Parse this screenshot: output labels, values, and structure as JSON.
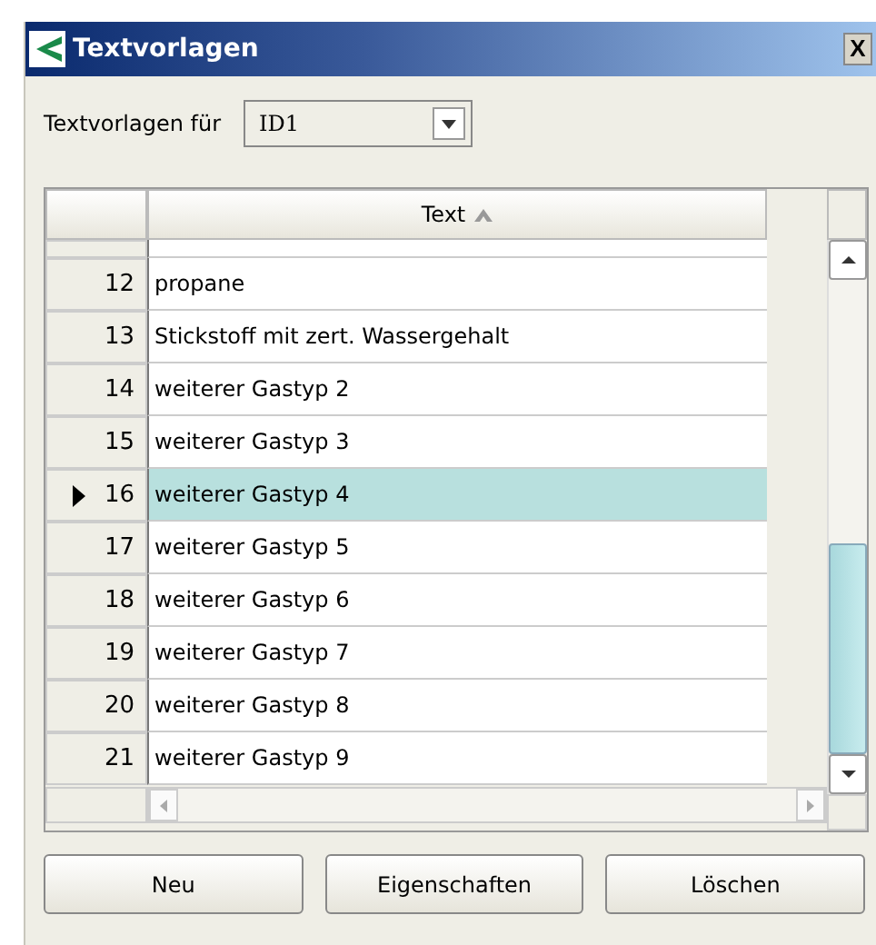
{
  "window": {
    "title": "Textvorlagen",
    "close": "X"
  },
  "filter": {
    "label": "Textvorlagen für",
    "value": "ID1"
  },
  "table": {
    "columns": [
      {
        "label": "Text",
        "sorted_ascending": true
      }
    ],
    "rows": [
      {
        "number": "12",
        "text": "propane",
        "selected": false
      },
      {
        "number": "13",
        "text": "Stickstoff mit zert. Wassergehalt",
        "selected": false
      },
      {
        "number": "14",
        "text": "weiterer Gastyp 2",
        "selected": false
      },
      {
        "number": "15",
        "text": "weiterer Gastyp 3",
        "selected": false
      },
      {
        "number": "16",
        "text": "weiterer Gastyp 4",
        "selected": true
      },
      {
        "number": "17",
        "text": "weiterer Gastyp 5",
        "selected": false
      },
      {
        "number": "18",
        "text": "weiterer Gastyp 6",
        "selected": false
      },
      {
        "number": "19",
        "text": "weiterer Gastyp 7",
        "selected": false
      },
      {
        "number": "20",
        "text": "weiterer Gastyp 8",
        "selected": false
      },
      {
        "number": "21",
        "text": "weiterer Gastyp 9",
        "selected": false
      }
    ]
  },
  "buttons": [
    "Neu",
    "Eigenschaften",
    "Löschen"
  ]
}
